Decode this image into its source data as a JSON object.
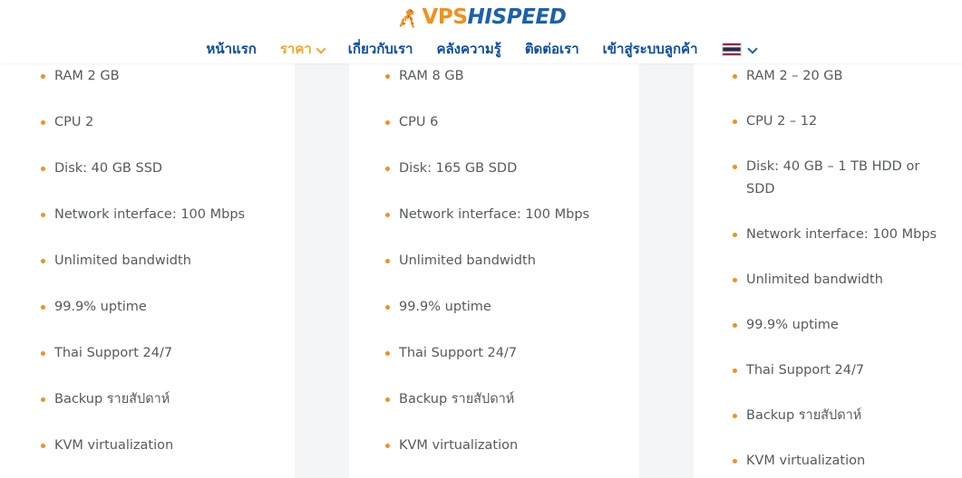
{
  "header": {
    "logo": {
      "mascot_icon": "cheetah-mascot-icon",
      "part1": "VPS",
      "part2": "HISPEED"
    },
    "nav": [
      {
        "label": "หน้าแรก",
        "active": false,
        "has_caret": false
      },
      {
        "label": "ราคา",
        "active": true,
        "has_caret": true
      },
      {
        "label": "เกี่ยวกับเรา",
        "active": false,
        "has_caret": false
      },
      {
        "label": "คลังความรู้",
        "active": false,
        "has_caret": false
      },
      {
        "label": "ติดต่อเรา",
        "active": false,
        "has_caret": false
      },
      {
        "label": "เข้าสู่ระบบลูกค้า",
        "active": false,
        "has_caret": false
      }
    ],
    "language": {
      "flag_icon": "thailand-flag-icon",
      "caret_icon": "chevron-down-icon"
    }
  },
  "colors": {
    "brand_orange": "#F3901D",
    "brand_blue": "#1B60AE",
    "nav_blue": "#0B4EA2",
    "active_orange": "#F5A623",
    "feature_text": "#555A5E",
    "gutter_gray": "#EFF1F4"
  },
  "plans": [
    {
      "id": "plan-1",
      "features": [
        "RAM 2 GB",
        "CPU 2",
        "Disk: 40 GB SSD",
        "Network interface: 100 Mbps",
        "Unlimited bandwidth",
        "99.9% uptime",
        "Thai Support 24/7",
        "Backup รายสัปดาห์",
        "KVM virtualization"
      ]
    },
    {
      "id": "plan-2",
      "features": [
        "RAM 8 GB",
        "CPU 6",
        "Disk: 165 GB SDD",
        "Network interface: 100 Mbps",
        "Unlimited bandwidth",
        "99.9% uptime",
        "Thai Support 24/7",
        "Backup รายสัปดาห์",
        "KVM virtualization"
      ]
    },
    {
      "id": "plan-3",
      "features": [
        "RAM 2 – 20 GB",
        "CPU 2 – 12",
        "Disk: 40 GB – 1 TB HDD or SDD",
        "Network interface: 100 Mbps",
        "Unlimited bandwidth",
        "99.9% uptime",
        "Thai Support 24/7",
        "Backup รายสัปดาห์",
        "KVM virtualization"
      ]
    }
  ]
}
